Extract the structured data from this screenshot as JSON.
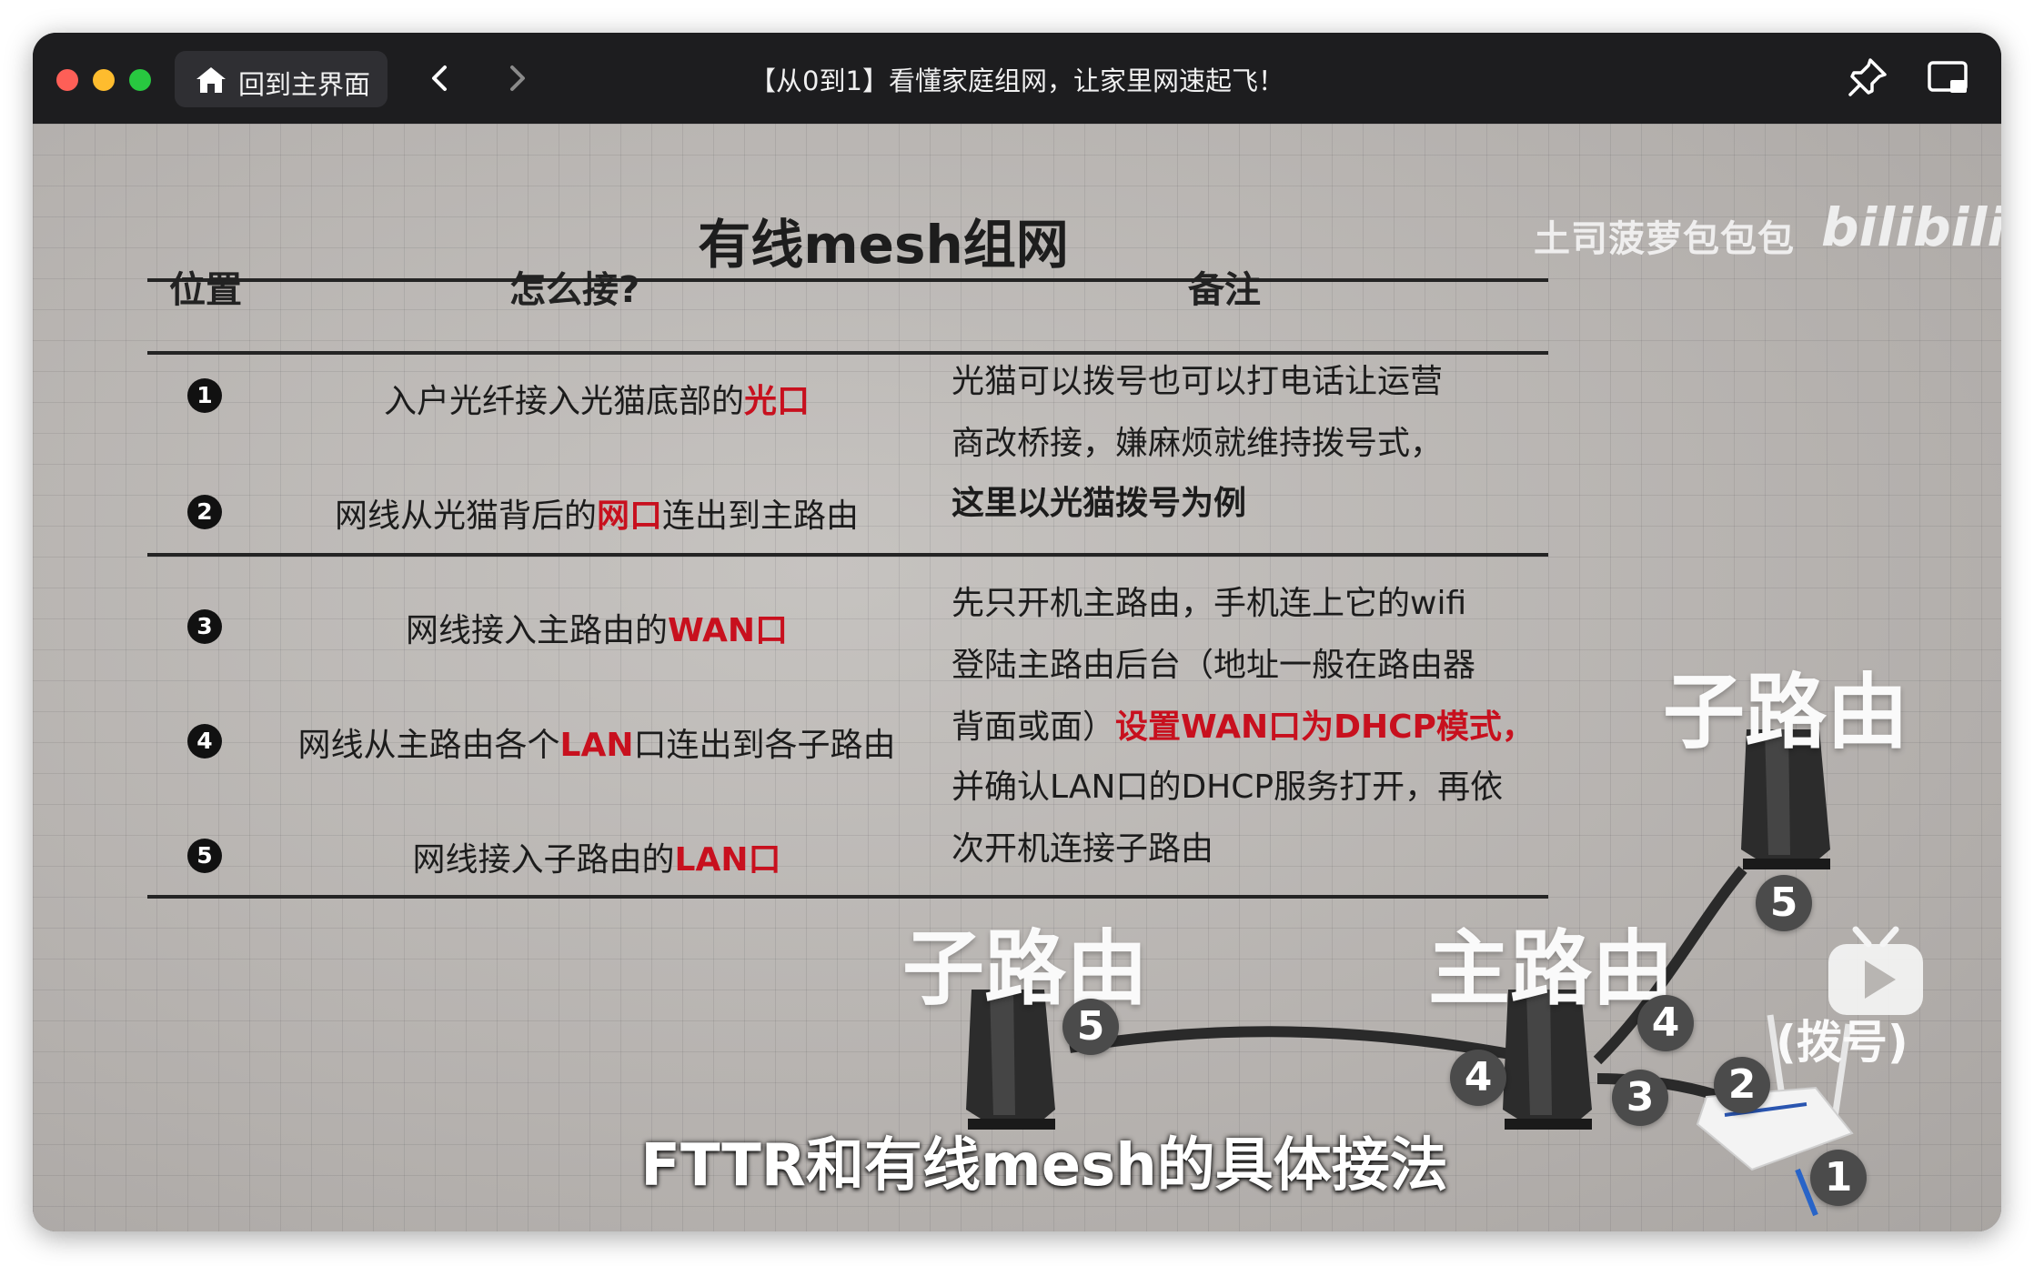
{
  "window": {
    "home_button_label": "回到主界面",
    "title": "【从0到1】看懂家庭组网，让家里网速起飞！"
  },
  "slide": {
    "title": "有线mesh组网",
    "headers": {
      "position": "位置",
      "how": "怎么接?",
      "note": "备注"
    },
    "rows": [
      {
        "num": "1",
        "text": "入户光纤接入光猫底部的",
        "highlight": "光口",
        "after": ""
      },
      {
        "num": "2",
        "text": "网线从光猫背后的",
        "highlight": "网口",
        "after": "连出到主路由"
      },
      {
        "num": "3",
        "text": "网线接入主路由的",
        "highlight": "WAN口",
        "after": ""
      },
      {
        "num": "4",
        "text": "网线从主路由各个",
        "highlight": "LAN",
        "after": "口连出到各子路由"
      },
      {
        "num": "5",
        "text": "网线接入子路由的",
        "highlight": "LAN口",
        "after": ""
      }
    ],
    "note_group1": {
      "line1": "光猫可以拨号也可以打电话让运营",
      "line2": "商改桥接，嫌麻烦就维持拨号式，",
      "line3_red": "这里以光猫拨号为例"
    },
    "note_group2": {
      "line1": "先只开机主路由，手机连上它的wifi",
      "line2": "登陆主路由后台（地址一般在路由器",
      "line3_pre": "背面或面）",
      "line3_red": "设置WAN口为DHCP模式，",
      "line4": "并确认LAN口的DHCP服务打开，再依",
      "line5": "次开机连接子路由"
    }
  },
  "overlay": {
    "watermark": "土司菠萝包包包",
    "bili_logo": "bilibili",
    "label_sub_router_right": "子路由",
    "label_sub_router_left": "子路由",
    "label_main_router": "主路由",
    "label_dial": "(拨号)",
    "subtitle": "FTTR和有线mesh的具体接法",
    "port_numbers": [
      "5",
      "5",
      "4",
      "4",
      "3",
      "2",
      "1"
    ]
  },
  "player": {
    "progress_fraction": 0.81
  },
  "colors": {
    "highlight_red": "#c8101e",
    "progress": "#f0457a"
  },
  "icons": [
    "house-icon",
    "chevron-left-icon",
    "chevron-right-icon",
    "pin-icon",
    "picture-in-picture-icon",
    "play-icon"
  ]
}
